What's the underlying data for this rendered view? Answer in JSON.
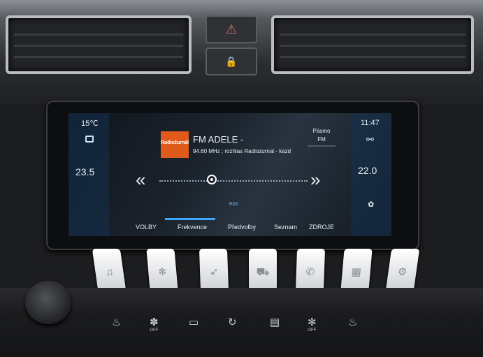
{
  "status": {
    "outside_temp": "15℃",
    "clock": "11:47"
  },
  "climate": {
    "left_temp": "23.5",
    "right_temp": "22.0"
  },
  "radio": {
    "logo_text": "Radiožurnál",
    "station_name": "FM ADELE -",
    "frequency_text": "94.60 MHz ; rozhlas Radiozurnal - kazd",
    "band_label": "Pásmo",
    "band_value": "FM",
    "rds_label": "RDS",
    "prev_label": "«",
    "next_label": "»"
  },
  "tabs": [
    {
      "label": "VOLBY"
    },
    {
      "label": "Frekvence"
    },
    {
      "label": "Předvolby"
    },
    {
      "label": "Seznam"
    },
    {
      "label": "ZDROJE"
    }
  ],
  "buttons": {
    "hazard": "⚠",
    "lock": "🔒",
    "rear_defrost": "OFF",
    "fan_off": "OFF"
  },
  "colors": {
    "accent": "#3fa6ff",
    "station_logo": "#e05a1c",
    "hazard_red": "#d87070"
  }
}
